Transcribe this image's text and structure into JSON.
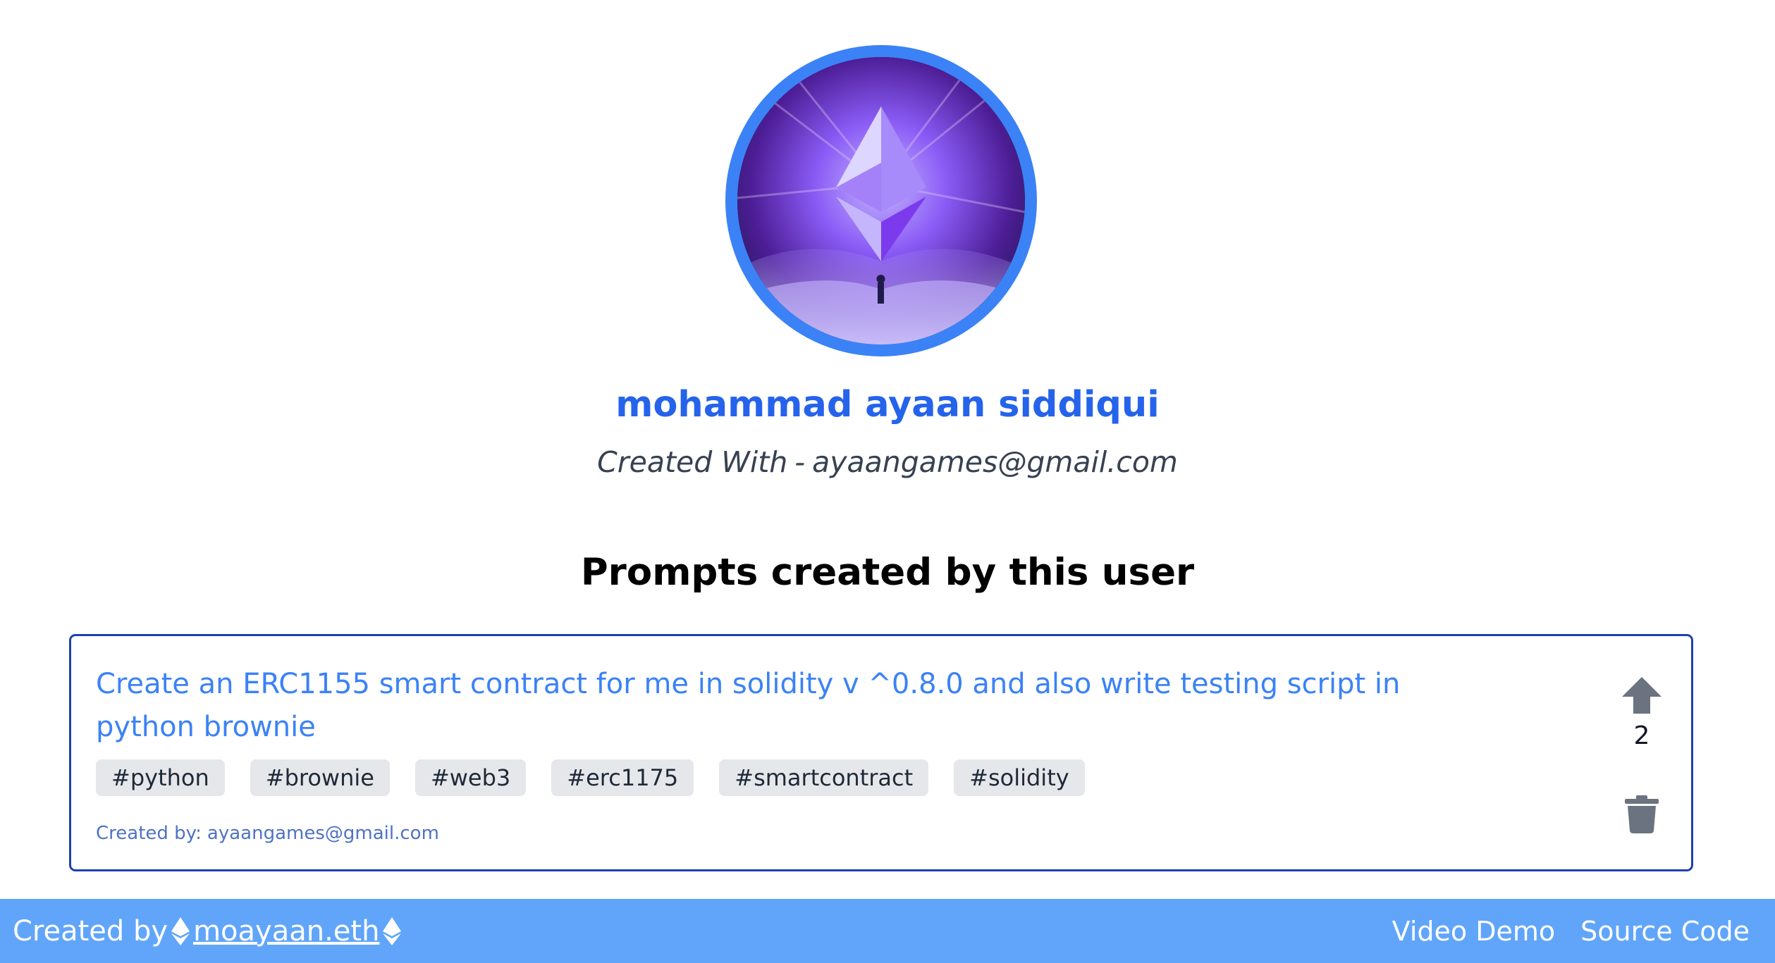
{
  "profile": {
    "name": "mohammad ayaan siddiqui",
    "created_with_label": "Created With",
    "separator": "-",
    "email": "ayaangames@gmail.com",
    "ring_color": "#3b82f6"
  },
  "section_title": "Prompts created by this user",
  "prompt": {
    "text": "Create an ERC1155 smart contract for me in solidity v ^0.8.0 and also write testing script in python brownie",
    "tags": [
      "#python",
      "#brownie",
      "#web3",
      "#erc1175",
      "#smartcontract",
      "#solidity"
    ],
    "created_by_label": "Created by:",
    "created_by_email": "ayaangames@gmail.com",
    "votes": "2",
    "upvote_icon": "arrow-up-icon",
    "delete_icon": "trash-icon"
  },
  "footer": {
    "created_by_label": "Created by",
    "author_link": "moayaan.eth",
    "links": [
      "Video Demo",
      "Source Code"
    ],
    "background": "#60a5fa"
  }
}
